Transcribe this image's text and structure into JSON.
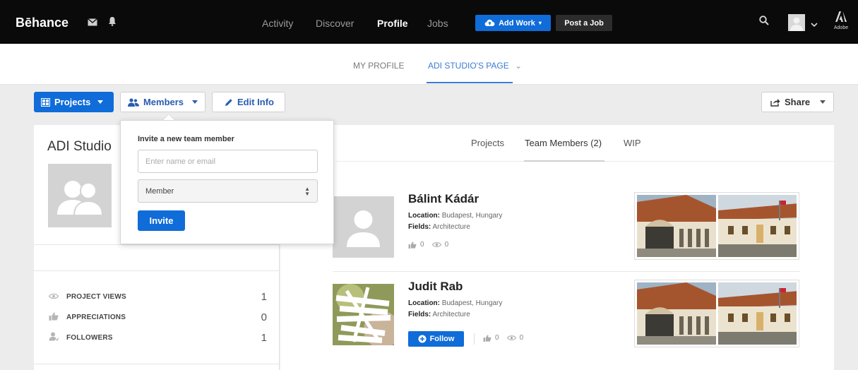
{
  "topbar": {
    "logo": "Bēhance",
    "nav": [
      "Activity",
      "Discover",
      "Profile",
      "Jobs"
    ],
    "add_work": "Add Work",
    "add_work_caret": "▾",
    "post_job": "Post a Job",
    "adobe_label": "Adobe"
  },
  "subnav": {
    "my_profile": "MY PROFILE",
    "studio_page": "ADI STUDIO'S PAGE",
    "caret": "⌄"
  },
  "actions": {
    "projects": "Projects",
    "members": "Members",
    "edit_info": "Edit Info",
    "share": "Share"
  },
  "left": {
    "studio_name": "ADI Studio",
    "stats": [
      {
        "label": "PROJECT VIEWS",
        "value": "1"
      },
      {
        "label": "APPRECIATIONS",
        "value": "0"
      },
      {
        "label": "FOLLOWERS",
        "value": "1"
      }
    ]
  },
  "tabs": [
    "Projects",
    "Team Members (2)",
    "WIP"
  ],
  "members": [
    {
      "name": "Bálint Kádár",
      "location_label": "Location:",
      "location": "Budapest, Hungary",
      "fields_label": "Fields:",
      "fields": "Architecture",
      "appreciations": "0",
      "views": "0"
    },
    {
      "name": "Judit Rab",
      "location_label": "Location:",
      "location": "Budapest, Hungary",
      "fields_label": "Fields:",
      "fields": "Architecture",
      "appreciations": "0",
      "views": "0",
      "follow": "Follow"
    }
  ],
  "popover": {
    "title": "Invite a new team member",
    "input_placeholder": "Enter name or email",
    "role": "Member",
    "invite": "Invite"
  },
  "colors": {
    "primary": "#0f6cd8",
    "topbar": "#0a0a0a",
    "tab_active": "#3a7bd5"
  }
}
